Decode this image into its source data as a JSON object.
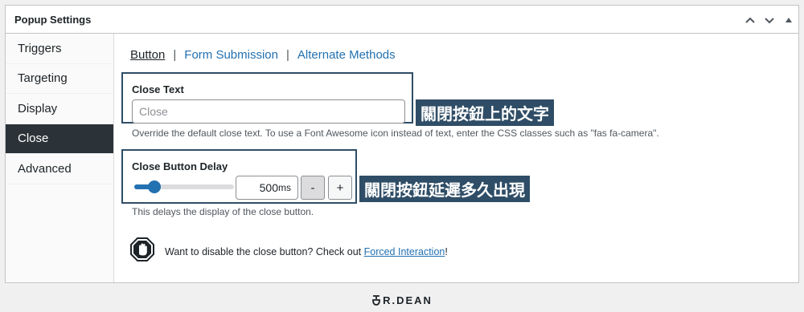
{
  "panel": {
    "title": "Popup Settings",
    "controls": [
      "chevron-up-icon",
      "chevron-down-icon",
      "triangle-up-icon"
    ]
  },
  "sidebar": {
    "items": [
      {
        "label": "Triggers",
        "active": false
      },
      {
        "label": "Targeting",
        "active": false
      },
      {
        "label": "Display",
        "active": false
      },
      {
        "label": "Close",
        "active": true
      },
      {
        "label": "Advanced",
        "active": false
      }
    ]
  },
  "subnav": {
    "items": [
      {
        "label": "Button",
        "current": true
      },
      {
        "label": "Form Submission",
        "current": false
      },
      {
        "label": "Alternate Methods",
        "current": false
      }
    ],
    "separator": "|"
  },
  "close_text": {
    "label": "Close Text",
    "value": "",
    "placeholder": "Close",
    "description": "Override the default close text. To use a Font Awesome icon instead of text, enter the CSS classes such as \"fas fa-camera\".",
    "callout": "關閉按鈕上的文字"
  },
  "close_delay": {
    "label": "Close Button Delay",
    "value": "500",
    "unit": "ms",
    "slider_fraction": 0.2,
    "minus": "-",
    "plus": "+",
    "description": "This delays the display of the close button.",
    "callout": "關閉按鈕延遲多久出現"
  },
  "notice": {
    "text": "Want to disable the close button? Check out ",
    "link": "Forced Interaction",
    "suffix": "!"
  },
  "footer": {
    "brand": "R.DEAN"
  },
  "colors": {
    "accent": "#2271b1",
    "active_tab": "#2c3338",
    "callout_bg": "#2f4d66"
  }
}
